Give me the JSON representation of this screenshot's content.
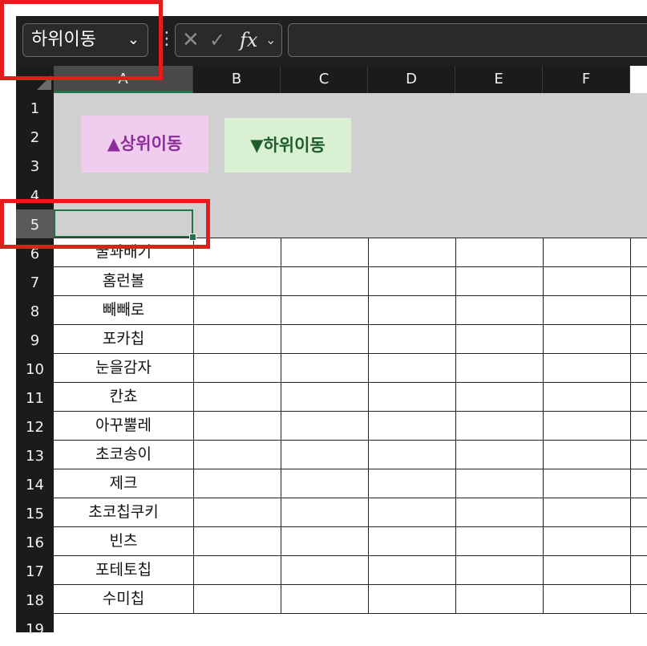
{
  "name_box": {
    "value": "하위이동"
  },
  "formula_bar": {
    "cancel_glyph": "✕",
    "enter_glyph": "✓",
    "fx_label": "fx",
    "formula_value": ""
  },
  "columns": [
    "A",
    "B",
    "C",
    "D",
    "E",
    "F"
  ],
  "selected_column": "A",
  "rows": [
    "1",
    "2",
    "3",
    "4",
    "5",
    "6",
    "7",
    "8",
    "9",
    "10",
    "11",
    "12",
    "13",
    "14",
    "15",
    "16",
    "17",
    "18",
    "19"
  ],
  "selected_row": "5",
  "buttons": {
    "move_up": "▲상위이동",
    "move_down": "▼하위이동"
  },
  "column_a_values": [
    "꿀꽈배기",
    "홈런볼",
    "빼빼로",
    "포카칩",
    "눈을감자",
    "칸쵸",
    "아꾸뿔레",
    "초코송이",
    "제크",
    "초코칩쿠키",
    "빈츠",
    "포테토칩",
    "수미칩"
  ],
  "colors": {
    "banner_gray": "#d0d0d0",
    "up_button_bg": "#f0cdee",
    "down_button_bg": "#d9f1d2",
    "highlight_red": "#e51c1c",
    "selection_green": "#217346"
  }
}
